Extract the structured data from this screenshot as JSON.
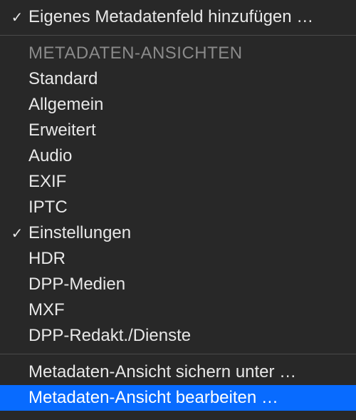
{
  "topItem": {
    "checked": true,
    "label": "Eigenes Metadatenfeld hinzufügen …"
  },
  "sectionHeader": "METADATEN-ANSICHTEN",
  "views": [
    {
      "checked": false,
      "label": "Standard"
    },
    {
      "checked": false,
      "label": "Allgemein"
    },
    {
      "checked": false,
      "label": "Erweitert"
    },
    {
      "checked": false,
      "label": "Audio"
    },
    {
      "checked": false,
      "label": "EXIF"
    },
    {
      "checked": false,
      "label": "IPTC"
    },
    {
      "checked": true,
      "label": "Einstellungen"
    },
    {
      "checked": false,
      "label": "HDR"
    },
    {
      "checked": false,
      "label": "DPP-Medien"
    },
    {
      "checked": false,
      "label": "MXF"
    },
    {
      "checked": false,
      "label": "DPP-Redakt./Dienste"
    }
  ],
  "bottomItems": [
    {
      "label": "Metadaten-Ansicht sichern unter …",
      "highlighted": false
    },
    {
      "label": "Metadaten-Ansicht bearbeiten …",
      "highlighted": true
    }
  ],
  "checkmarkGlyph": "✓"
}
